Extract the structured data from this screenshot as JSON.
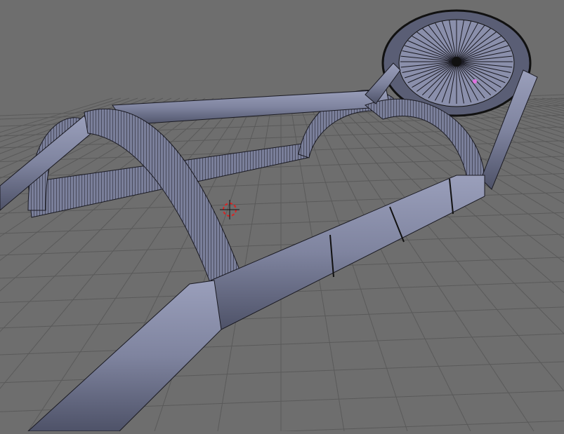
{
  "viewport": {
    "background_color": "#6e6e6e",
    "grid_color": "#5a5a5a",
    "mesh_color": "#8a8fab",
    "mesh_shade_color": "#5c6078",
    "edge_color": "#1a1a22",
    "vertex_color": "#000000",
    "selected_vertex_color": "#e070e0",
    "cursor_icon": "3d-cursor-icon"
  }
}
